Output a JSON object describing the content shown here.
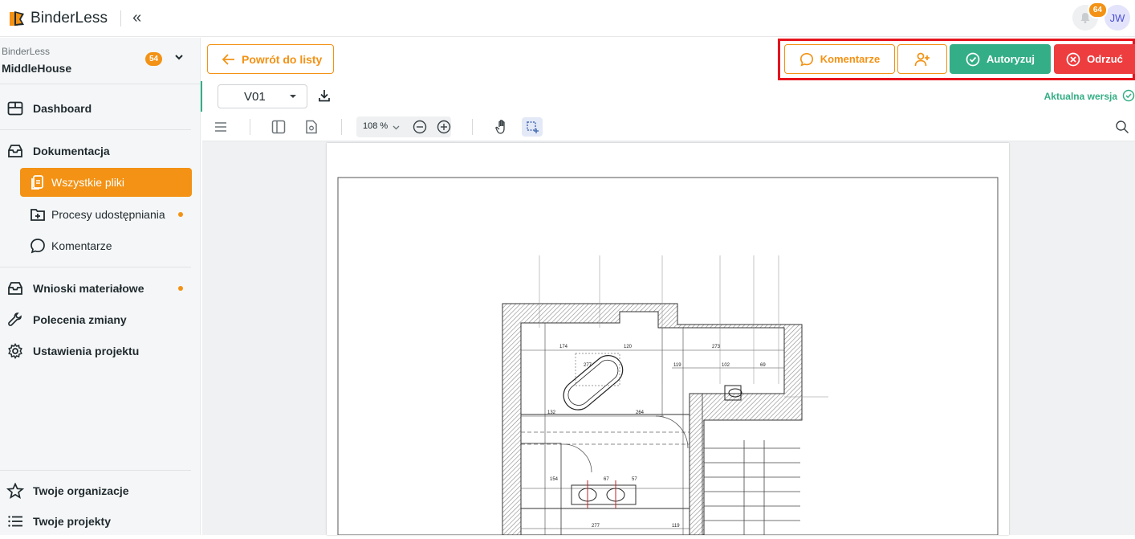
{
  "app": {
    "name": "BinderLess",
    "notifications_count": "64",
    "user_initials": "JW"
  },
  "sidebar": {
    "org_name": "BinderLess",
    "project_name": "MiddleHouse",
    "project_badge": "54",
    "items": [
      {
        "label": "Dashboard",
        "icon": "dashboard-icon"
      },
      {
        "label": "Dokumentacja",
        "icon": "inbox-icon"
      },
      {
        "label": "Wszystkie pliki",
        "icon": "files-icon",
        "active": true
      },
      {
        "label": "Procesy udostępniania",
        "icon": "share-process-icon",
        "dot": true
      },
      {
        "label": "Komentarze",
        "icon": "comment-icon"
      },
      {
        "label": "Wnioski materiałowe",
        "icon": "material-requests-icon",
        "dot": true
      },
      {
        "label": "Polecenia zmiany",
        "icon": "wrench-icon"
      },
      {
        "label": "Ustawienia projektu",
        "icon": "gear-icon"
      },
      {
        "label": "Twoje organizacje",
        "icon": "star-icon"
      },
      {
        "label": "Twoje projekty",
        "icon": "list-icon"
      }
    ]
  },
  "header": {
    "back_label": "Powrót do listy",
    "comments_label": "Komentarze",
    "authorize_label": "Autoryzuj",
    "reject_label": "Odrzuć"
  },
  "viewer": {
    "version": "V01",
    "current_version_label": "Aktualna wersja",
    "zoom": "108 %"
  },
  "colors": {
    "accent": "#f39214",
    "success": "#34ae86",
    "danger": "#ee3d3f",
    "highlight": "#e6141d"
  }
}
